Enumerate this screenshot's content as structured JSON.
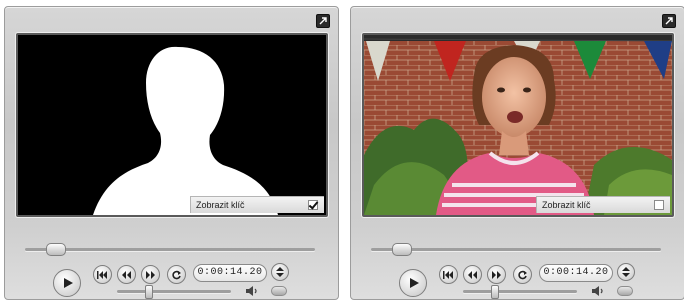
{
  "players": [
    {
      "preview": "key-mask",
      "key_toggle": {
        "label": "Zobrazit klíč",
        "checked": true
      },
      "timecode": "0:00:14.20",
      "scrub_position": 0.08,
      "volume_level": 0.3
    },
    {
      "preview": "video-frame",
      "key_toggle": {
        "label": "Zobrazit klíč",
        "checked": false
      },
      "timecode": "0:00:14.20",
      "scrub_position": 0.08,
      "volume_level": 0.3
    }
  ],
  "icons": {
    "expand": "expand-icon",
    "play": "play-icon",
    "go_to_start": "go-to-start-icon",
    "step_back": "step-back-icon",
    "step_forward": "step-forward-icon",
    "loop": "loop-icon",
    "timecode_stepper": "up-down-stepper-icon",
    "volume": "speaker-icon"
  },
  "colors": {
    "panel": "#cfcfcf",
    "screen_border": "#5a5a5a",
    "mask_foreground": "#ffffff",
    "mask_background": "#000000"
  }
}
